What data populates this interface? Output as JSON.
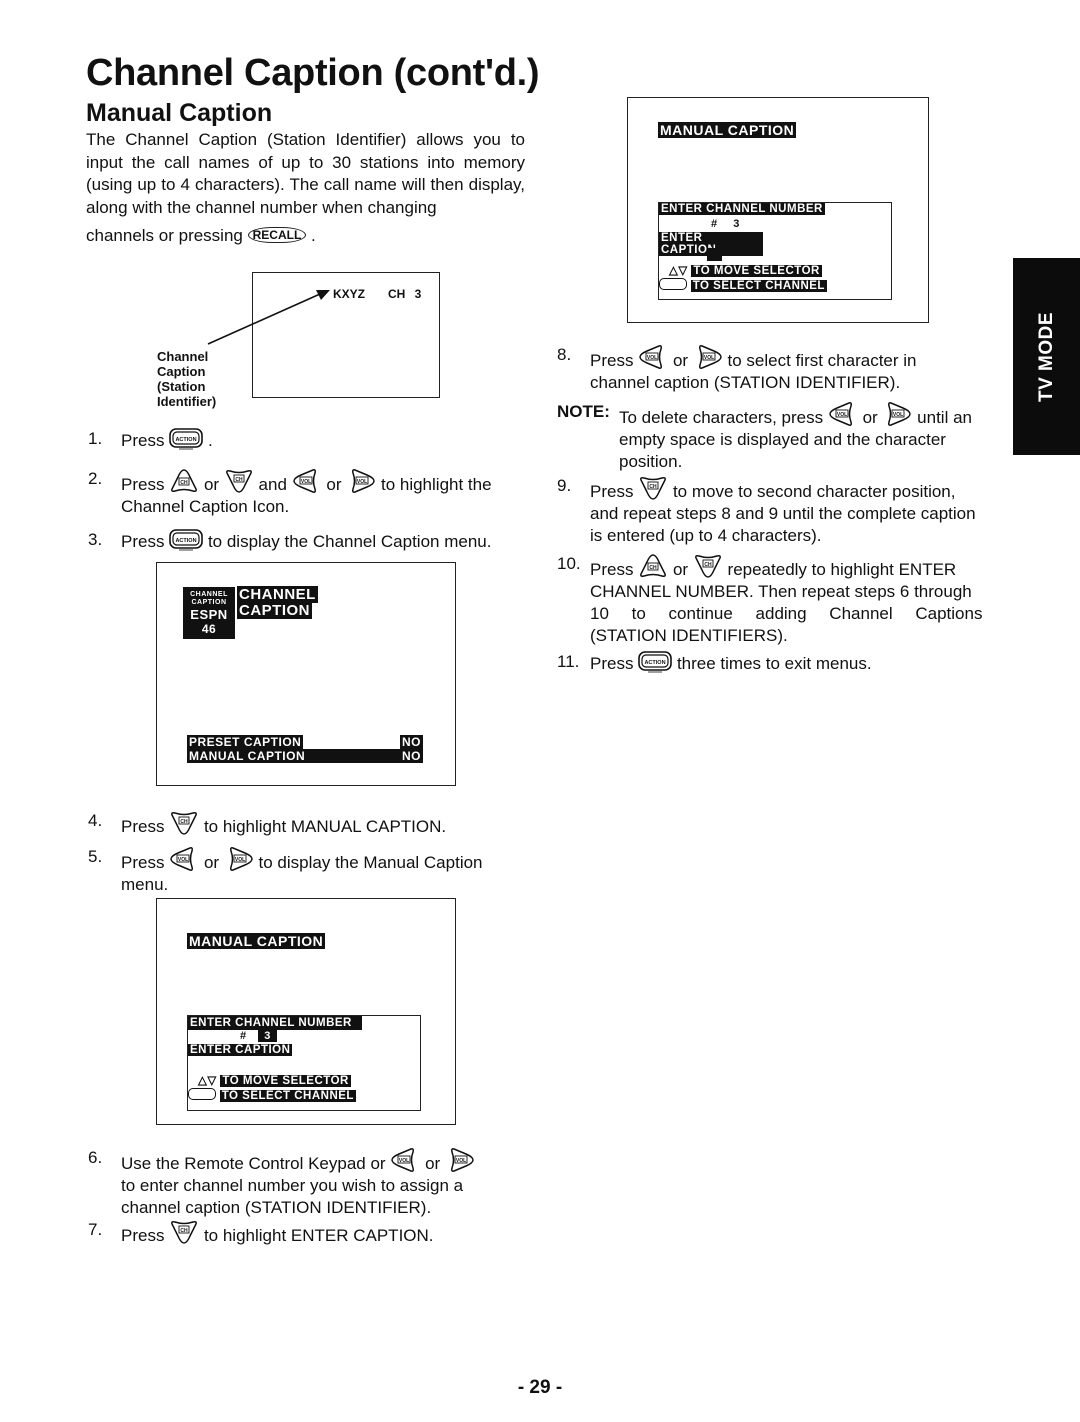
{
  "page": {
    "title": "Channel Caption (cont'd.)",
    "subtitle": "Manual Caption",
    "intro": "The Channel Caption (Station Identifier) allows you to input the call names of up to 30 stations into memory (using up to 4 characters). The call name will then display, along with the channel number when changing",
    "intro_end": "channels or pressing",
    "recall_button": "RECALL",
    "page_number": "- 29 -",
    "side_tab": "TV MODE"
  },
  "figure1": {
    "station": "KXYZ",
    "channel": "CH 3",
    "callout": [
      "Channel",
      "Caption",
      "(Station",
      "Identifier)"
    ]
  },
  "icons": {
    "action": "ACTION",
    "ch": "CH",
    "vol": "VOL"
  },
  "steps": [
    {
      "num": "1.",
      "text_a": "Press",
      "text_b": "."
    },
    {
      "num": "2.",
      "text_a": "Press",
      "or1": "or",
      "and": "and",
      "or2": "or",
      "text_b": "to highlight the",
      "text_c": "Channel Caption Icon."
    },
    {
      "num": "3.",
      "text_a": "Press",
      "text_b": "to display the Channel Caption menu."
    },
    {
      "num": "4.",
      "text_a": "Press",
      "text_b": "to highlight MANUAL CAPTION."
    },
    {
      "num": "5.",
      "text_a": "Press",
      "or1": "or",
      "text_b": "to display the Manual Caption",
      "text_c": "menu."
    },
    {
      "num": "6.",
      "text_a": "Use the Remote Control Keypad or",
      "or1": "or",
      "text_b": "to enter channel number you wish to assign a",
      "text_c": "channel caption (STATION IDENTIFIER)."
    },
    {
      "num": "7.",
      "text_a": "Press",
      "text_b": "to highlight ENTER CAPTION."
    },
    {
      "num": "8.",
      "text_a": "Press",
      "or1": "or",
      "text_b": "to select first character in",
      "text_c": "channel caption (STATION IDENTIFIER)."
    },
    {
      "num": "9.",
      "text_a": "Press",
      "text_b": "to move to second character position,",
      "text_c": "and repeat steps 8 and 9 until the complete caption",
      "text_d": "is entered (up to 4 characters)."
    },
    {
      "num": "10.",
      "text_a": "Press",
      "or1": "or",
      "text_b": "repeatedly to highlight ENTER",
      "text_c": "CHANNEL NUMBER. Then repeat steps 6 through",
      "text_d": "10 to continue adding Channel Captions",
      "text_e": "(STATION IDENTIFIERS)."
    },
    {
      "num": "11.",
      "text_a": "Press",
      "text_b": "three times to exit menus."
    }
  ],
  "note": {
    "label": "NOTE:",
    "text_a": "To delete characters, press",
    "or1": "or",
    "text_b": "until an",
    "text_c": "empty space is displayed and the character",
    "text_d": "position."
  },
  "screen_channel_caption": {
    "icon_line1": "CHANNEL",
    "icon_line2": "CAPTION",
    "icon_station": "ESPN",
    "icon_channel": "46",
    "heading_line1": "CHANNEL",
    "heading_line2": "CAPTION",
    "menu": [
      {
        "label": "PRESET CAPTION",
        "value": "NO"
      },
      {
        "label": "MANUAL CAPTION",
        "value": "NO"
      }
    ]
  },
  "screen_manual_caption_1": {
    "heading": "MANUAL CAPTION",
    "enter_channel": "ENTER CHANNEL NUMBER",
    "hash": "#",
    "channel_value": "3",
    "enter_caption": "ENTER CAPTION",
    "hint1": "TO MOVE SELECTOR",
    "hint2": "TO SELECT CHANNEL"
  },
  "screen_manual_caption_2": {
    "heading": "MANUAL CAPTION",
    "enter_channel": "ENTER CHANNEL NUMBER",
    "hash": "#",
    "channel_value": "3",
    "enter_caption": "ENTER CAPTION",
    "hint1": "TO MOVE SELECTOR",
    "hint2": "TO SELECT CHANNEL"
  }
}
